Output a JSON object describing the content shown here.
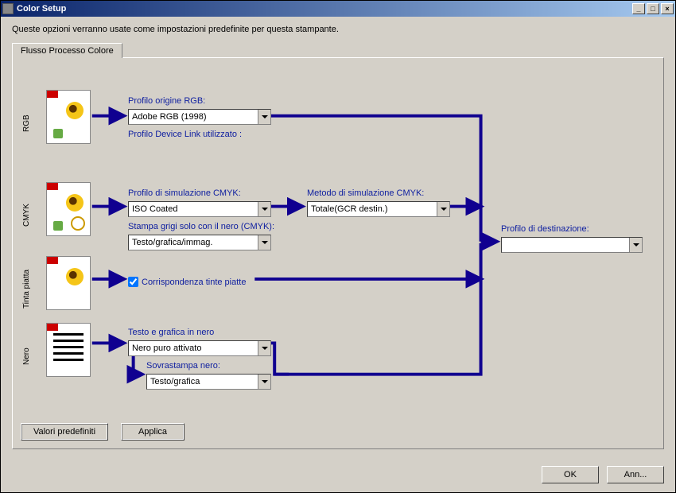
{
  "window": {
    "title": "Color Setup"
  },
  "intro": "Queste opzioni verranno usate come impostazioni predefinite per questa stampante.",
  "tab": "Flusso Processo Colore",
  "sections": {
    "rgb": "RGB",
    "cmyk": "CMYK",
    "spot": "Tinta piatta",
    "black": "Nero"
  },
  "labels": {
    "rgb_source": "Profilo origine RGB:",
    "device_link": "Profilo Device Link utilizzato :",
    "cmyk_sim_profile": "Profilo di simulazione CMYK:",
    "cmyk_sim_method": "Metodo di simulazione CMYK:",
    "gray_black_only": "Stampa grigi solo con il nero (CMYK):",
    "spot_match": "Corrispondenza tinte piatte",
    "black_text_graphics": "Testo e grafica in nero",
    "black_overprint": "Sovrastampa nero:",
    "output_profile": "Profilo di destinazione:"
  },
  "values": {
    "rgb_source": "Adobe RGB (1998)",
    "cmyk_sim_profile": "ISO Coated",
    "cmyk_sim_method": "Totale(GCR destin.)",
    "gray_black_only": "Testo/grafica/immag.",
    "black_text_graphics": "Nero puro attivato",
    "black_overprint": "Testo/grafica",
    "output_profile": ""
  },
  "buttons": {
    "defaults": "Valori predefiniti",
    "apply": "Applica",
    "ok": "OK",
    "cancel": "Ann..."
  },
  "colors": {
    "flow": "#100090"
  }
}
